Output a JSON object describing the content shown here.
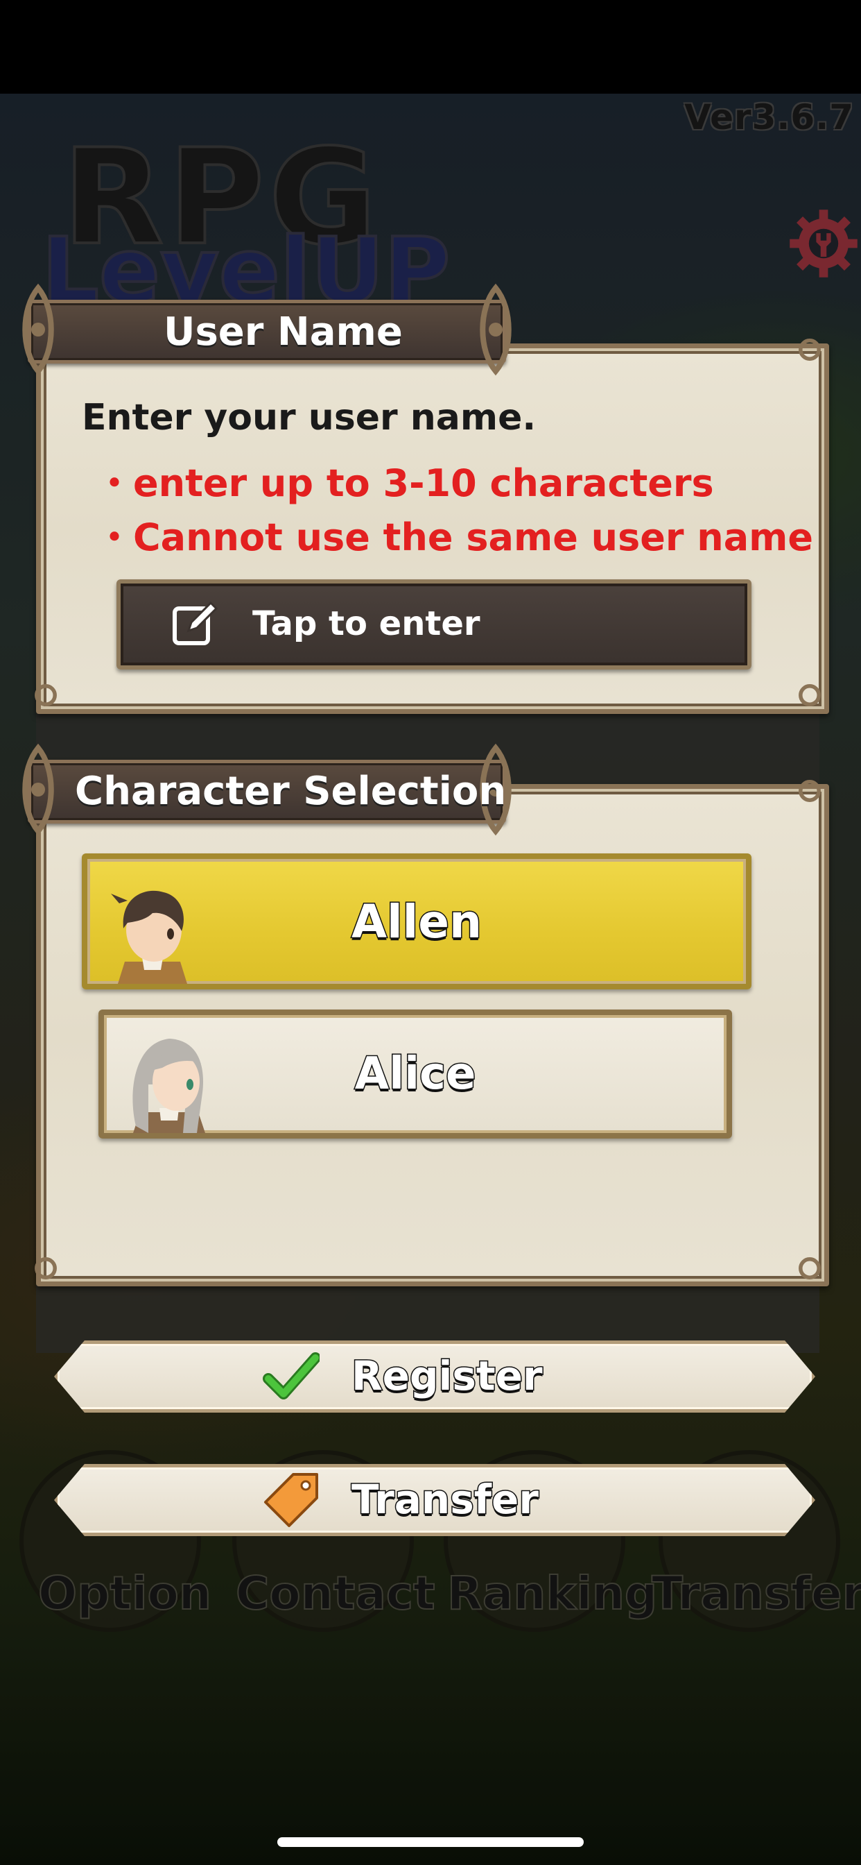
{
  "version": "Ver3.6.7",
  "logo": {
    "line1": "RPG",
    "line2": "LevelUP"
  },
  "user_name_panel": {
    "title": "User Name",
    "instruction": "Enter your user name.",
    "rules": [
      "・enter up to 3-10 characters",
      "・Cannot use the same user name"
    ],
    "input_label": "Tap to enter"
  },
  "character_panel": {
    "title": "Character Selection",
    "characters": [
      {
        "name": "Allen",
        "selected": true
      },
      {
        "name": "Alice",
        "selected": false
      }
    ]
  },
  "buttons": {
    "register": "Register",
    "transfer": "Transfer"
  },
  "background_menu": [
    "Option",
    "Contact",
    "Ranking",
    "Transfer"
  ],
  "colors": {
    "accent_red": "#e32020",
    "selected_yellow": "#e4c830",
    "panel_bg": "#e8e2d2",
    "frame_brown": "#8a7356",
    "check_green": "#4cc43c",
    "tag_orange": "#f39a3a",
    "gear_red": "#7a2830"
  },
  "icons": [
    "gear-icon",
    "edit-icon",
    "check-icon",
    "tag-icon"
  ]
}
